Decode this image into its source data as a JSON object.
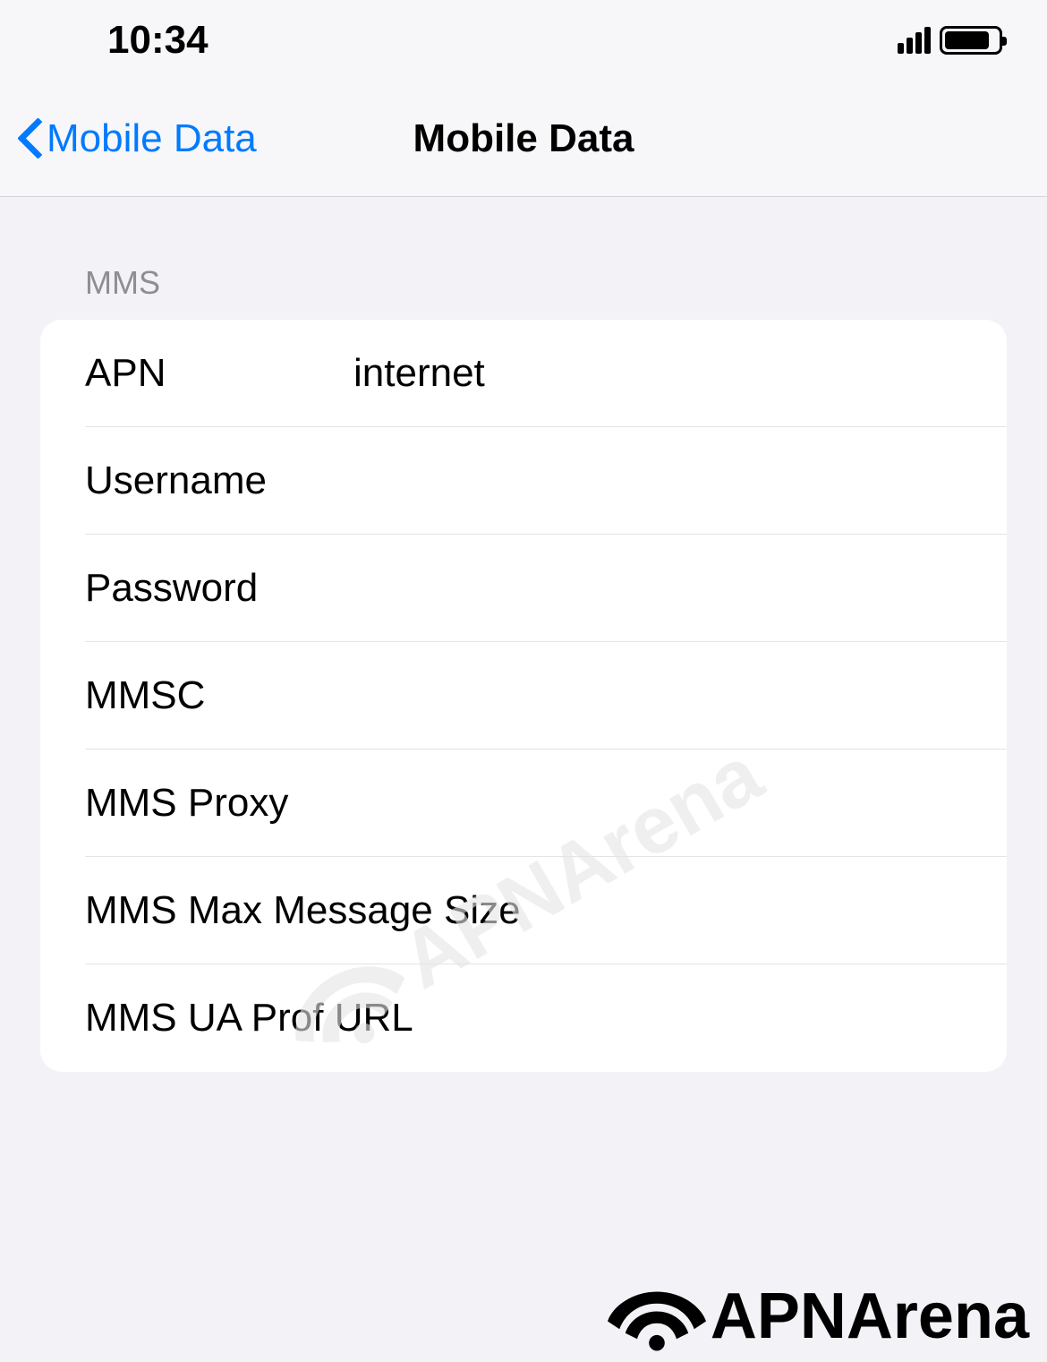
{
  "status_bar": {
    "time": "10:34"
  },
  "nav": {
    "back_label": "Mobile Data",
    "title": "Mobile Data"
  },
  "section": {
    "header": "MMS",
    "fields": {
      "apn": {
        "label": "APN",
        "value": "internet"
      },
      "username": {
        "label": "Username",
        "value": ""
      },
      "password": {
        "label": "Password",
        "value": ""
      },
      "mmsc": {
        "label": "MMSC",
        "value": ""
      },
      "mms_proxy": {
        "label": "MMS Proxy",
        "value": ""
      },
      "mms_max_size": {
        "label": "MMS Max Message Size",
        "value": ""
      },
      "mms_ua_prof": {
        "label": "MMS UA Prof URL",
        "value": ""
      }
    }
  },
  "watermark": "APNArena",
  "footer_brand": "APNArena"
}
